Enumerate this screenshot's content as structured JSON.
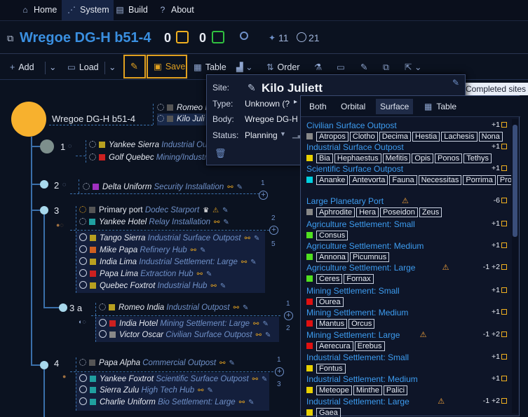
{
  "nav": {
    "home": "Home",
    "system": "System",
    "build": "Build",
    "about": "About"
  },
  "header": {
    "title": "Wregoe DG-H b51-4",
    "count1": "0",
    "count2": "0",
    "stat1": "11",
    "stat2": "21"
  },
  "toolbar": {
    "add": "Add",
    "load": "Load",
    "save": "Save",
    "table": "Table",
    "order": "Order"
  },
  "system": {
    "name": "Wregoe DG-H b51-4"
  },
  "tree": {
    "root_sites": [
      {
        "name": "Romeo I",
        "type": ""
      },
      {
        "name": "Kilo Juli",
        "type": ""
      }
    ],
    "b1": {
      "label": "1",
      "sites": [
        {
          "name": "Yankee Sierra",
          "type": "Industrial Outp",
          "color": "#b8a020"
        },
        {
          "name": "Golf Quebec",
          "type": "Mining/Industr",
          "color": "#cc2020"
        }
      ]
    },
    "b2": {
      "label": "2",
      "badge": "1",
      "sites": [
        {
          "name": "Delta Uniform",
          "type": "Security Installation",
          "color": "#a030c0"
        }
      ]
    },
    "b3": {
      "label": "3",
      "badge_top": "2",
      "badge_bot": "5",
      "orbital": [
        {
          "name": "Primary port",
          "type": "Dodec Starport",
          "color": "#555"
        },
        {
          "name": "Yankee Hotel",
          "type": "Relay Installation",
          "color": "#20a0a0"
        }
      ],
      "surface": [
        {
          "name": "Tango Sierra",
          "type": "Industrial Surface Outpost",
          "color": "#b8a020"
        },
        {
          "name": "Mike Papa",
          "type": "Refinery Hub",
          "color": "#d06020"
        },
        {
          "name": "India Lima",
          "type": "Industrial Settlement: Large",
          "color": "#b8a020"
        },
        {
          "name": "Papa Lima",
          "type": "Extraction Hub",
          "color": "#cc2020"
        },
        {
          "name": "Quebec Foxtrot",
          "type": "Industrial Hub",
          "color": "#b8a020"
        }
      ]
    },
    "b3a": {
      "label": "3 a",
      "badge_top": "1",
      "badge_bot": "2",
      "orbital": [
        {
          "name": "Romeo India",
          "type": "Industrial Outpost",
          "color": "#b8a020"
        }
      ],
      "surface": [
        {
          "name": "India Hotel",
          "type": "Mining Settlement: Large",
          "color": "#cc2020"
        },
        {
          "name": "Victor Oscar",
          "type": "Civilian Surface Outpost",
          "color": "#888"
        }
      ]
    },
    "b4": {
      "label": "4",
      "badge_top": "1",
      "badge_bot": "3",
      "orbital": [
        {
          "name": "Papa Alpha",
          "type": "Commercial Outpost",
          "color": "#555"
        }
      ],
      "surface": [
        {
          "name": "Yankee Foxtrot",
          "type": "Scientific Surface Outpost",
          "color": "#20a0a0"
        },
        {
          "name": "Sierra Zulu",
          "type": "High Tech Hub",
          "color": "#20a0a0"
        },
        {
          "name": "Charlie Uniform",
          "type": "Bio Settlement: Large",
          "color": "#20a0a0"
        }
      ]
    }
  },
  "site_popup": {
    "site_label": "Site:",
    "site_name": "Kilo Juliett",
    "type_label": "Type:",
    "type_value": "Unknown (?",
    "body_label": "Body:",
    "body_value": "Wregoe DG-H E",
    "status_label": "Status:",
    "status_value": "Planning"
  },
  "notification": "Completed sites c",
  "type_menu": {
    "tabs": {
      "both": "Both",
      "orbital": "Orbital",
      "surface": "Surface",
      "table": "Table"
    },
    "items": [
      {
        "title": "Civilian Surface Outpost",
        "score": "+1",
        "warn": false,
        "color": "#888",
        "bodies": [
          "Atropos",
          "Clotho",
          "Decima",
          "Hestia",
          "Lachesis",
          "Nona"
        ]
      },
      {
        "title": "Industrial Surface Outpost",
        "score": "+1",
        "warn": false,
        "color": "#e8d000",
        "bodies": [
          "Bia",
          "Hephaestus",
          "Mefitis",
          "Opis",
          "Ponos",
          "Tethys"
        ]
      },
      {
        "title": "Scientific Surface Outpost",
        "score": "+1",
        "warn": false,
        "color": "#00d0e0",
        "bodies": [
          "Ananke",
          "Antevorta",
          "Fauna",
          "Necessitas",
          "Porrima",
          "Providentia"
        ]
      },
      {
        "title": "Large Planetary Port",
        "score": "-6",
        "warn": true,
        "color": "#888",
        "bodies": [
          "Aphrodite",
          "Hera",
          "Poseidon",
          "Zeus"
        ]
      },
      {
        "title": "Agriculture Settlement: Small",
        "score": "+1",
        "warn": false,
        "color": "#50e020",
        "bodies": [
          "Consus"
        ]
      },
      {
        "title": "Agriculture Settlement: Medium",
        "score": "+1",
        "warn": false,
        "color": "#50e020",
        "bodies": [
          "Annona",
          "Picumnus"
        ]
      },
      {
        "title": "Agriculture Settlement: Large",
        "score": "-1  +2",
        "warn": true,
        "color": "#50e020",
        "bodies": [
          "Ceres",
          "Fornax"
        ]
      },
      {
        "title": "Mining Settlement: Small",
        "score": "+1",
        "warn": false,
        "color": "#e01010",
        "bodies": [
          "Ourea"
        ]
      },
      {
        "title": "Mining Settlement: Medium",
        "score": "+1",
        "warn": false,
        "color": "#e01010",
        "bodies": [
          "Mantus",
          "Orcus"
        ]
      },
      {
        "title": "Mining Settlement: Large",
        "score": "-1  +2",
        "warn": true,
        "color": "#e01010",
        "bodies": [
          "Aerecura",
          "Erebus"
        ]
      },
      {
        "title": "Industrial Settlement: Small",
        "score": "+1",
        "warn": false,
        "color": "#e8d000",
        "bodies": [
          "Fontus"
        ]
      },
      {
        "title": "Industrial Settlement: Medium",
        "score": "+1",
        "warn": false,
        "color": "#e8d000",
        "bodies": [
          "Meteope",
          "Minthe",
          "Palici"
        ]
      },
      {
        "title": "Industrial Settlement: Large",
        "score": "-1  +2",
        "warn": true,
        "color": "#e8d000",
        "bodies": [
          "Gaea"
        ]
      }
    ]
  }
}
